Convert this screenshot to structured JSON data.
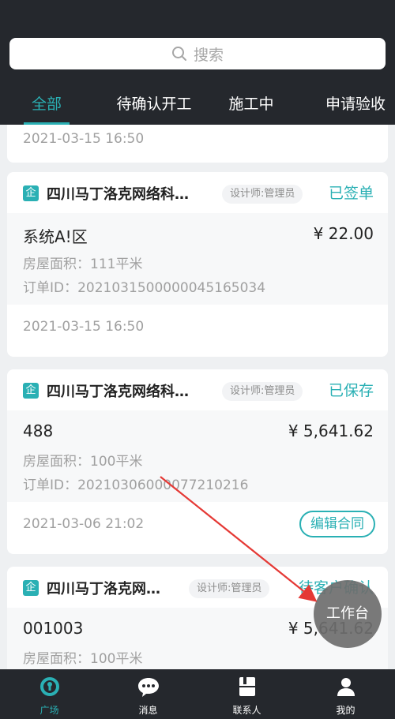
{
  "search": {
    "placeholder": "搜索"
  },
  "tabs": [
    {
      "label": "全部",
      "active": true
    },
    {
      "label": "待确认开工",
      "active": false
    },
    {
      "label": "施工中",
      "active": false
    },
    {
      "label": "申请验收",
      "active": false
    }
  ],
  "cards": [
    {
      "time": "2021-03-15 16:50"
    },
    {
      "company": "四川马丁洛克网络科…",
      "role": "设计师:管理员",
      "status": "已签单",
      "order_name": "系统A!区",
      "price": "¥ 22.00",
      "area": "房屋面积：111平米",
      "order_id": "订单ID：2021031500000045165034",
      "time": "2021-03-15 16:50"
    },
    {
      "company": "四川马丁洛克网络科…",
      "role": "设计师:管理员",
      "status": "已保存",
      "order_name": "488",
      "price": "¥ 5,641.62",
      "area": "房屋面积：100平米",
      "order_id": "订单ID：20210306000077210216",
      "time": "2021-03-06 21:02",
      "action": "编辑合同"
    },
    {
      "company": "四川马丁洛克网…",
      "role": "设计师:管理员",
      "status": "待客户确认",
      "order_name": "001003",
      "price": "¥ 5,641.62",
      "area": "房屋面积：100平米"
    }
  ],
  "float_button": {
    "label": "工作台"
  },
  "bottom_nav": [
    {
      "label": "广场",
      "icon": "plaza-icon",
      "active": true
    },
    {
      "label": "消息",
      "icon": "message-icon",
      "active": false
    },
    {
      "label": "联系人",
      "icon": "contacts-icon",
      "active": false
    },
    {
      "label": "我的",
      "icon": "user-icon",
      "active": false
    }
  ],
  "colors": {
    "accent": "#2ab0b4",
    "header_bg": "#25282d",
    "arrow": "#e53935"
  }
}
